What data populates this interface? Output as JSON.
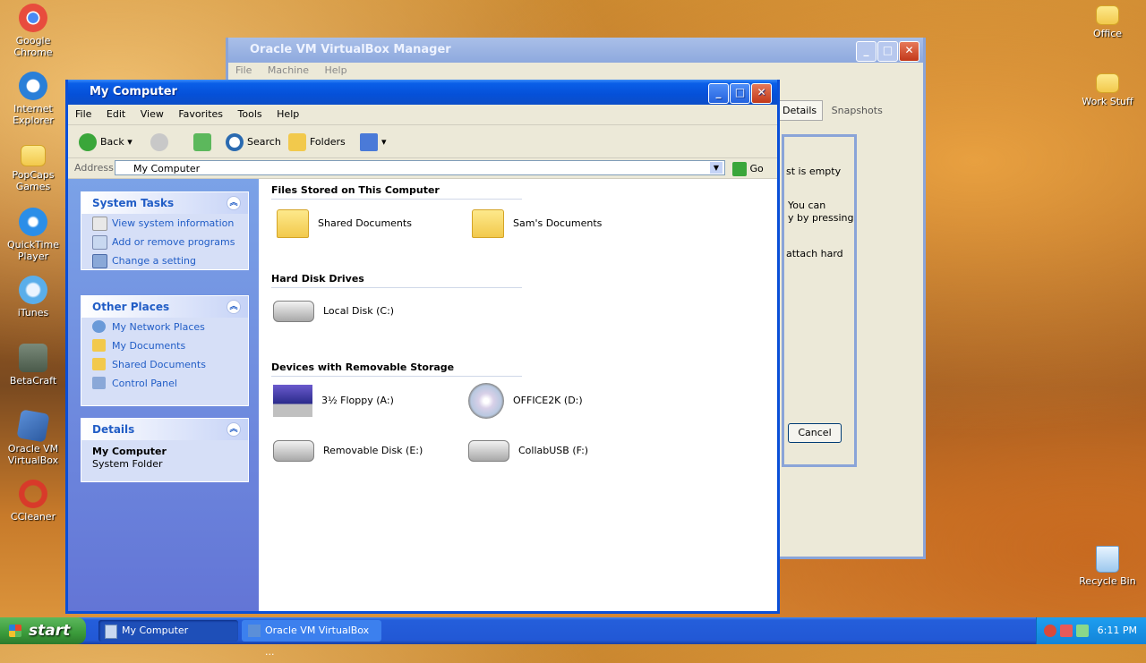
{
  "desktop": {
    "left_icons": [
      {
        "label": "Google Chrome",
        "icon": "chrome-icon",
        "color": "#e84c3d"
      },
      {
        "label": "Internet Explorer",
        "icon": "ie-icon",
        "color": "#2a7fd8"
      },
      {
        "label": "PopCaps Games",
        "icon": "folder-icon",
        "color": "#f2c94c"
      },
      {
        "label": "QuickTime Player",
        "icon": "quicktime-icon",
        "color": "#2b8ee8"
      },
      {
        "label": "iTunes",
        "icon": "itunes-icon",
        "color": "#5aaeea"
      },
      {
        "label": "BetaCraft",
        "icon": "betacraft-icon",
        "color": "#5a6a5a"
      },
      {
        "label": "Oracle VM VirtualBox",
        "icon": "virtualbox-icon",
        "color": "#2c5aa0"
      },
      {
        "label": "CCleaner",
        "icon": "ccleaner-icon",
        "color": "#d83a2a"
      }
    ],
    "right_icons": [
      {
        "label": "Office",
        "icon": "folder-icon"
      },
      {
        "label": "Work Stuff",
        "icon": "folder-icon"
      },
      {
        "label": "Recycle Bin",
        "icon": "recycle-bin-icon"
      }
    ]
  },
  "vbox": {
    "title": "Oracle VM VirtualBox Manager",
    "menu": [
      "File",
      "Machine",
      "Help"
    ],
    "tabs": [
      "Details",
      "Snapshots"
    ],
    "dialog_text": [
      "st is empty",
      "You can",
      "y by pressing",
      "attach hard"
    ],
    "cancel_label": "Cancel"
  },
  "explorer": {
    "title": "My Computer",
    "menu": [
      "File",
      "Edit",
      "View",
      "Favorites",
      "Tools",
      "Help"
    ],
    "toolbar": {
      "back": "Back",
      "search": "Search",
      "folders": "Folders"
    },
    "address": {
      "label": "Address",
      "value": "My Computer",
      "go": "Go"
    },
    "panels": {
      "system_tasks": {
        "title": "System Tasks",
        "items": [
          "View system information",
          "Add or remove programs",
          "Change a setting"
        ]
      },
      "other_places": {
        "title": "Other Places",
        "items": [
          "My Network Places",
          "My Documents",
          "Shared Documents",
          "Control Panel"
        ]
      },
      "details": {
        "title": "Details",
        "name": "My Computer",
        "type": "System Folder"
      }
    },
    "groups": {
      "files": {
        "title": "Files Stored on This Computer",
        "items": [
          "Shared Documents",
          "Sam's Documents"
        ]
      },
      "hdd": {
        "title": "Hard Disk Drives",
        "items": [
          "Local Disk (C:)"
        ]
      },
      "removable": {
        "title": "Devices with Removable Storage",
        "items": [
          "3½ Floppy (A:)",
          "OFFICE2K (D:)",
          "Removable Disk (E:)",
          "CollabUSB (F:)"
        ]
      }
    }
  },
  "taskbar": {
    "start": "start",
    "tasks": [
      "My Computer",
      "Oracle VM VirtualBox ..."
    ],
    "clock": "6:11 PM"
  }
}
